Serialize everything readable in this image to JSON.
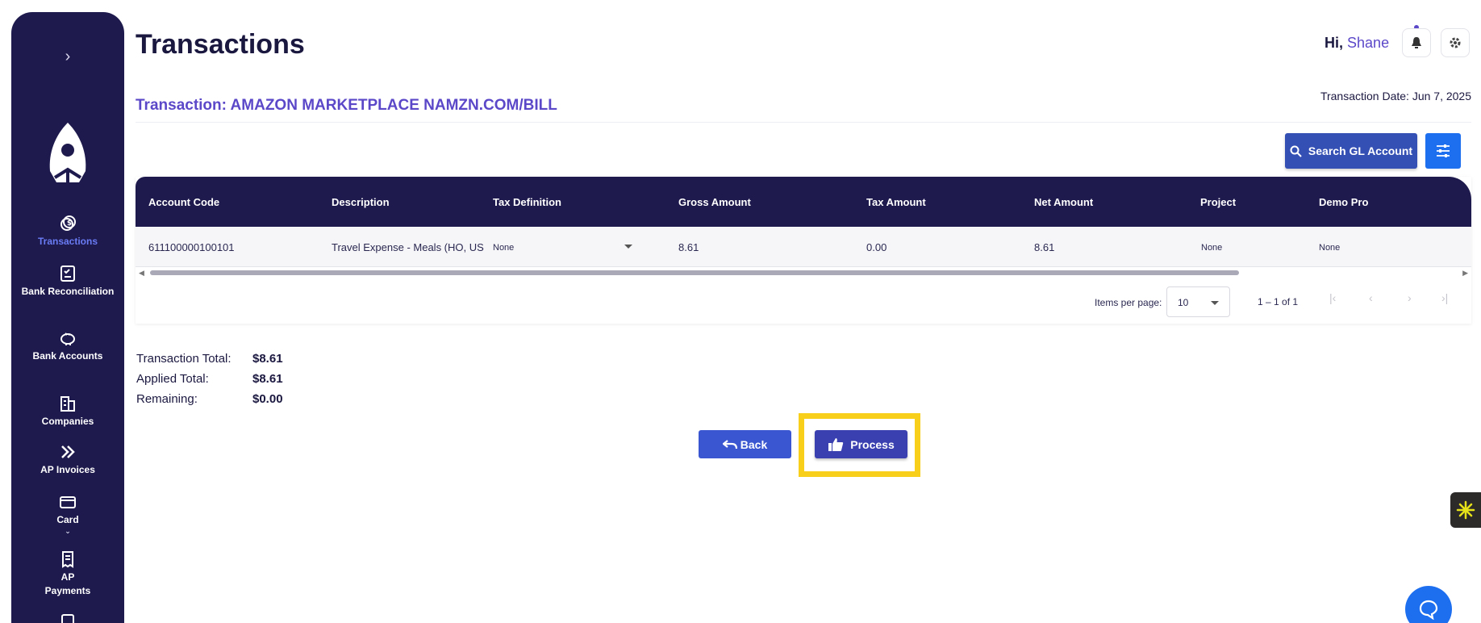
{
  "header": {
    "title": "Transactions",
    "greeting": "Hi,",
    "user_name": "Shane"
  },
  "sidebar": {
    "items": [
      {
        "label": "Transactions",
        "icon": "dollar-coin-icon"
      },
      {
        "label": "Bank Reconciliation",
        "icon": "checklist-icon"
      },
      {
        "label": "Bank Accounts",
        "icon": "piggy-bank-icon"
      },
      {
        "label": "Companies",
        "icon": "building-icon"
      },
      {
        "label": "AP Invoices",
        "icon": "double-chevron-right-icon"
      },
      {
        "label": "Card",
        "icon": "card-icon"
      },
      {
        "label": "AP Payments",
        "icon": "receipt-icon"
      }
    ],
    "card_caret": "⌄"
  },
  "transaction": {
    "title": "Transaction: AMAZON MARKETPLACE NAMZN.COM/BILL",
    "date": "Transaction Date: Jun 7, 2025"
  },
  "toolbar": {
    "search_gl_label": "Search GL Account"
  },
  "table": {
    "columns": [
      "Account Code",
      "Description",
      "Tax Definition",
      "Gross Amount",
      "Tax Amount",
      "Net Amount",
      "Project",
      "Demo Pro"
    ],
    "rows": [
      {
        "account_code": "611100000100101",
        "description": "Travel Expense - Meals (HO, US",
        "tax_definition": "None",
        "gross_amount": "8.61",
        "tax_amount": "0.00",
        "net_amount": "8.61",
        "project": "None",
        "demo_pro": "None"
      }
    ]
  },
  "pagination": {
    "items_per_page_label": "Items per page:",
    "items_per_page": "10",
    "range": "1 – 1 of 1"
  },
  "totals": {
    "transaction_total_label": "Transaction Total:",
    "transaction_total": "$8.61",
    "applied_total_label": "Applied Total:",
    "applied_total": "$8.61",
    "remaining_label": "Remaining:",
    "remaining": "$0.00"
  },
  "actions": {
    "back_label": "Back",
    "process_label": "Process"
  },
  "colors": {
    "sidebar_bg": "#1e1a4d",
    "accent": "#5b48c9",
    "primary_button": "#3a56d0",
    "highlight": "#f8cf1a"
  }
}
